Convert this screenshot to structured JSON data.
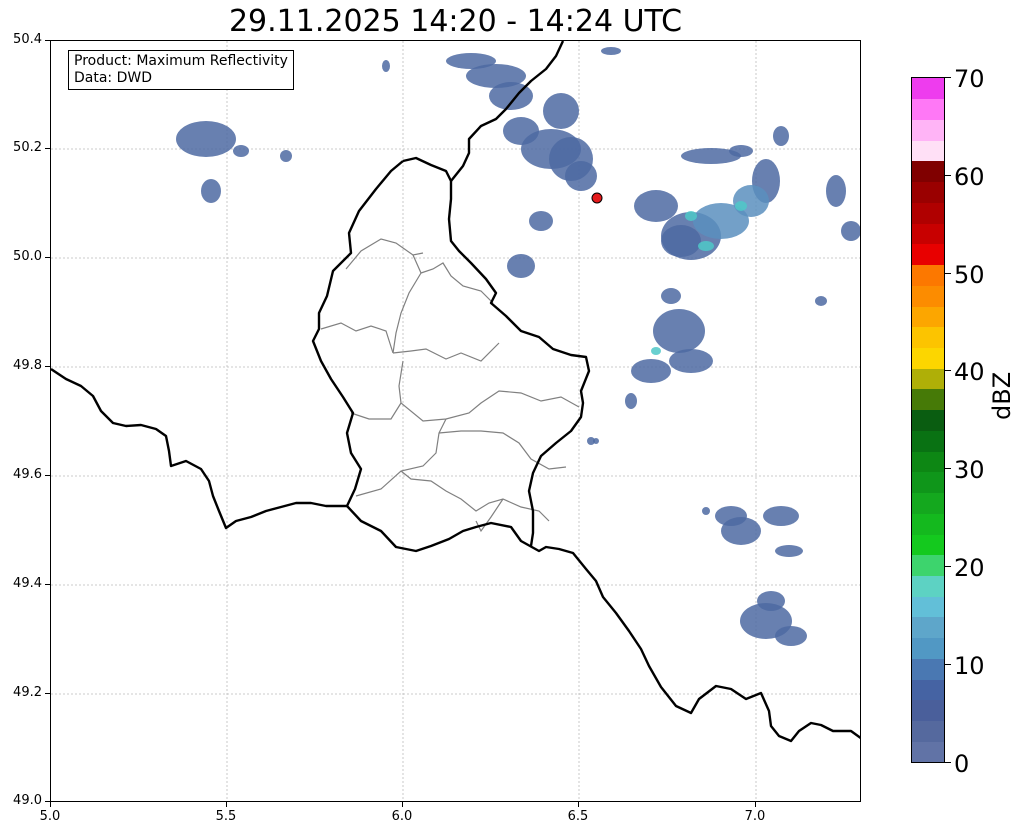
{
  "title": "29.11.2025 14:20 - 14:24 UTC",
  "info_box": {
    "product_line": "Product: Maximum Reflectivity",
    "data_line": "Data: DWD"
  },
  "axes": {
    "x_ticks": [
      "5.0",
      "5.5",
      "6.0",
      "6.5",
      "7.0"
    ],
    "y_ticks": [
      "50.4",
      "50.2",
      "50.0",
      "49.8",
      "49.6",
      "49.4",
      "49.2",
      "49.0"
    ],
    "x_range": [
      5.0,
      7.3
    ],
    "y_range": [
      49.0,
      50.4
    ],
    "grid": true
  },
  "colorbar": {
    "unit": "dBZ",
    "tick_labels": [
      "0",
      "10",
      "20",
      "30",
      "40",
      "50",
      "60",
      "70"
    ],
    "range": [
      0,
      70
    ],
    "colors": [
      "#6173a6",
      "#55699e",
      "#4a5f9b",
      "#4563a3",
      "#4a78b2",
      "#5198c4",
      "#5ea6ca",
      "#62bfd8",
      "#5dd2c3",
      "#3dd46d",
      "#14c91e",
      "#14b91e",
      "#14a81e",
      "#0f961a",
      "#0d8714",
      "#097213",
      "#0a5d11",
      "#467a07",
      "#afaf07",
      "#fcd600",
      "#fcc400",
      "#fca600",
      "#fc8c00",
      "#fc7800",
      "#e80000",
      "#c80000",
      "#b00000",
      "#9a0000",
      "#800000",
      "#ffe0f6",
      "#ffb4f6",
      "#ff78f6",
      "#ee3cee"
    ]
  },
  "station_marker": {
    "lon": 6.547,
    "lat": 50.11,
    "color": "#e41a1c"
  }
}
